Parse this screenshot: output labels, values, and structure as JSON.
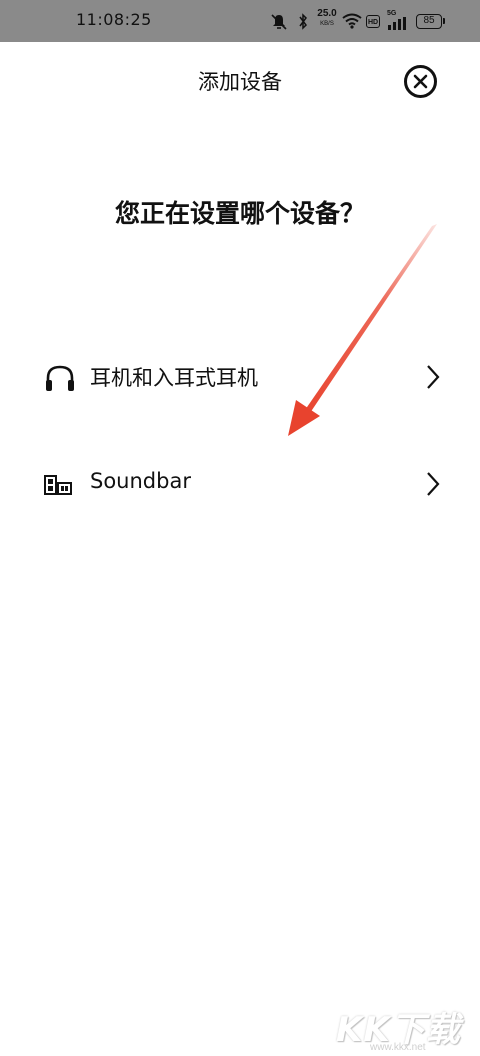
{
  "status_bar": {
    "time": "11:08:25",
    "net_speed_value": "25.0",
    "net_speed_unit": "KB/S",
    "hd_label": "HD",
    "network_type": "5G",
    "battery": "85"
  },
  "header": {
    "title": "添加设备"
  },
  "question": "您正在设置哪个设备？",
  "options": [
    {
      "label": "耳机和入耳式耳机",
      "icon": "headphones-icon"
    },
    {
      "label": "Soundbar",
      "icon": "soundbar-icon"
    }
  ],
  "watermark": {
    "text": "KK下载",
    "url": "www.kkx.net"
  },
  "colors": {
    "status_bar_bg": "#8a8a8a",
    "annotation_arrow": "#e8432e",
    "text": "#111111"
  }
}
